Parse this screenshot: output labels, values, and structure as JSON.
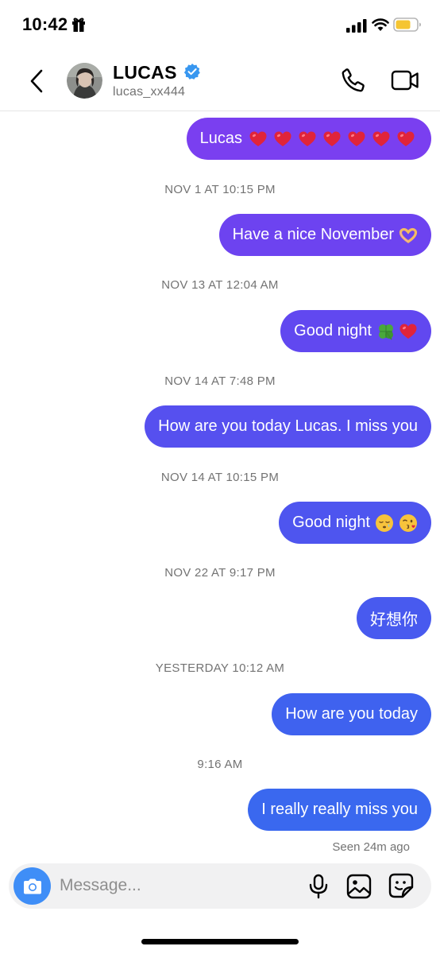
{
  "status_bar": {
    "time": "10:42"
  },
  "header": {
    "name": "LUCAS",
    "handle": "lucas_xx444"
  },
  "thread": [
    {
      "type": "message",
      "text": "Lucas",
      "emojis": [
        "red-heart",
        "red-heart",
        "red-heart",
        "red-heart",
        "red-heart",
        "red-heart",
        "red-heart"
      ],
      "color": "#7a3ff0"
    },
    {
      "type": "timestamp",
      "text": "NOV 1 AT 10:15 PM"
    },
    {
      "type": "message",
      "text": "Have a nice November",
      "emojis": [
        "heart-hands"
      ],
      "color": "#6d43f0"
    },
    {
      "type": "timestamp",
      "text": "NOV 13 AT 12:04 AM"
    },
    {
      "type": "message",
      "text": "Good night",
      "emojis": [
        "four-leaf-clover",
        "red-heart"
      ],
      "color": "#6148f0"
    },
    {
      "type": "timestamp",
      "text": "NOV 14 AT 7:48 PM"
    },
    {
      "type": "message",
      "text": "How are you today Lucas. I miss you",
      "emojis": [],
      "color": "#5650ef"
    },
    {
      "type": "timestamp",
      "text": "NOV 14 AT 10:15 PM"
    },
    {
      "type": "message",
      "text": "Good night",
      "emojis": [
        "sleepy-face",
        "kissing-face"
      ],
      "color": "#4e55ef"
    },
    {
      "type": "timestamp",
      "text": "NOV 22 AT 9:17 PM"
    },
    {
      "type": "message",
      "text": "好想你",
      "emojis": [],
      "color": "#485aef"
    },
    {
      "type": "timestamp",
      "text": "YESTERDAY 10:12 AM"
    },
    {
      "type": "message",
      "text": "How are you today",
      "emojis": [],
      "color": "#3f62ef"
    },
    {
      "type": "timestamp",
      "text": "9:16 AM"
    },
    {
      "type": "message",
      "text": "I really really miss you",
      "emojis": [],
      "color": "#3a68ef"
    }
  ],
  "seen_status": "Seen 24m ago",
  "composer": {
    "placeholder": "Message..."
  },
  "colors": {
    "accent_blue": "#3f8ef7",
    "verified_blue": "#3897f0"
  }
}
